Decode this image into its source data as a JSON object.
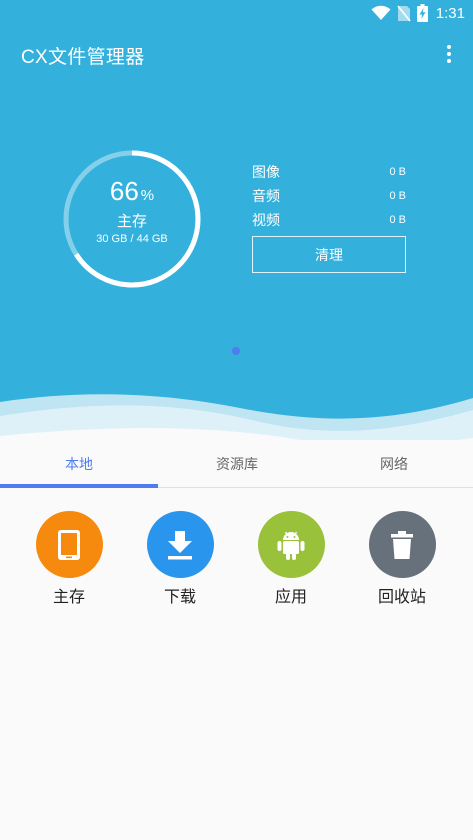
{
  "status_bar": {
    "time": "1:31",
    "icons": [
      "wifi-icon",
      "no-sim-icon",
      "battery-charging-icon"
    ]
  },
  "header": {
    "title": "CX文件管理器",
    "menu_icon": "more-vert-icon"
  },
  "storage": {
    "percent": "66",
    "percent_sign": "%",
    "label": "主存",
    "usage": "30 GB / 44 GB",
    "used_fraction": 0.66
  },
  "media": [
    {
      "label": "图像",
      "size": "0 B"
    },
    {
      "label": "音频",
      "size": "0 B"
    },
    {
      "label": "视频",
      "size": "0 B"
    }
  ],
  "clean_button": "清理",
  "tabs": [
    {
      "label": "本地",
      "active": true
    },
    {
      "label": "资源库",
      "active": false
    },
    {
      "label": "网络",
      "active": false
    }
  ],
  "shortcuts": [
    {
      "label": "主存",
      "icon": "tablet-icon",
      "color": "#f68a0f"
    },
    {
      "label": "下载",
      "icon": "download-icon",
      "color": "#2a95ec"
    },
    {
      "label": "应用",
      "icon": "android-icon",
      "color": "#9ac13a"
    },
    {
      "label": "回收站",
      "icon": "trash-icon",
      "color": "#66717b"
    }
  ],
  "colors": {
    "hero_background": "#33b1dc",
    "accent": "#4e7df0"
  }
}
